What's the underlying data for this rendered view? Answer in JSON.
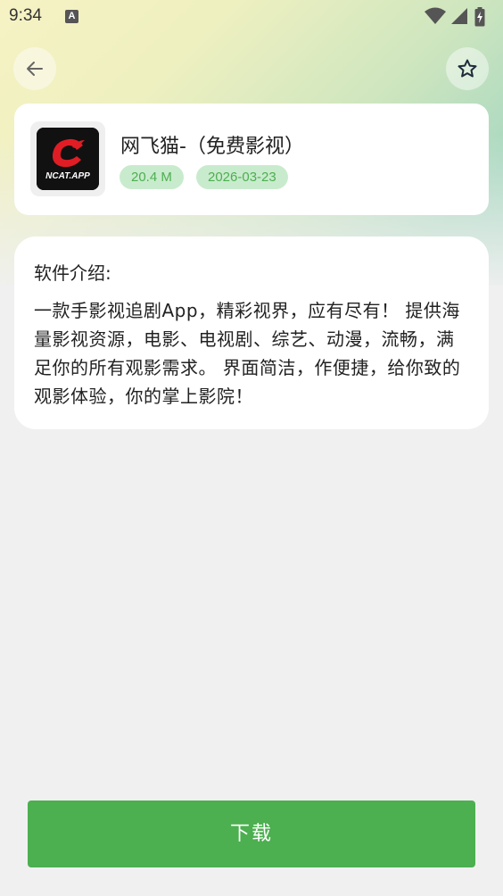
{
  "status_bar": {
    "time": "9:34",
    "notification_icon_letter": "A",
    "icons": [
      "wifi-icon",
      "cellular-signal-icon",
      "battery-charging-icon"
    ]
  },
  "toolbar": {
    "back_icon": "arrow-left-icon",
    "favorite_icon": "star-outline-icon"
  },
  "app": {
    "icon_text": "NCAT.APP",
    "name": "网飞猫-（免费影视）",
    "size": "20.4 M",
    "date": "2026-03-23"
  },
  "description": {
    "title": "软件介绍:",
    "body": "一款手影视追剧App，精彩视界，应有尽有！ 提供海量影视资源，电影、电视剧、综艺、动漫，流畅，满足你的所有观影需求。 界面简洁，作便捷，给你致的观影体验，你的掌上影院！"
  },
  "actions": {
    "download_label": "下载"
  },
  "colors": {
    "accent": "#4caf50",
    "tag_background": "#c9ebcd",
    "page_background": "#f0f0f0"
  }
}
